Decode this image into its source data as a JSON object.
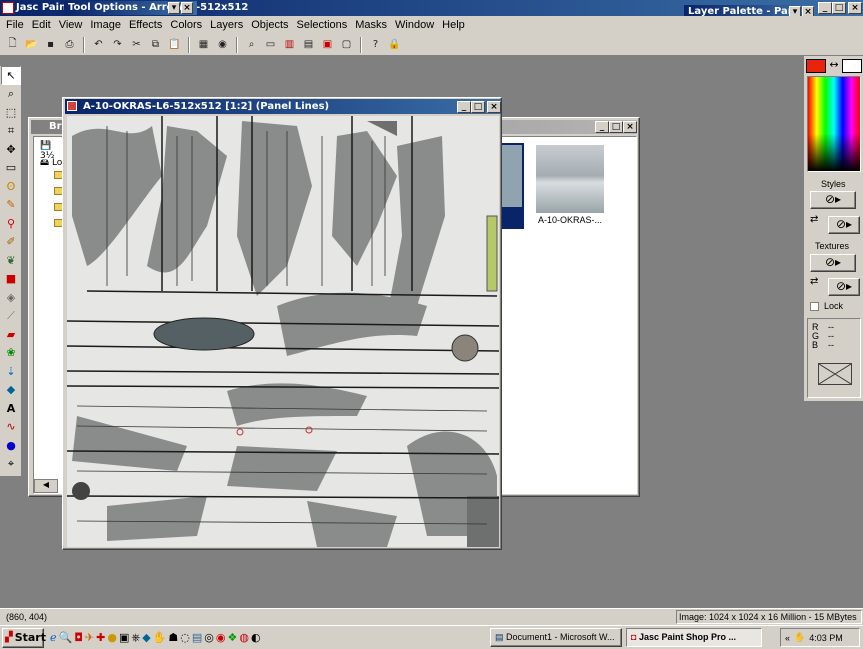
{
  "app": {
    "title_prefix": "Jasc Paint",
    "title_suffix": "-512x512",
    "tool_options_title": "Tool Options - Arrow",
    "layer_palette_title": "Layer Palette - Panel"
  },
  "menu": [
    "File",
    "Edit",
    "View",
    "Image",
    "Effects",
    "Colors",
    "Layers",
    "Objects",
    "Selections",
    "Masks",
    "Window",
    "Help"
  ],
  "toolbar_icons": [
    "new-icon",
    "open-icon",
    "save-icon",
    "print-icon",
    "undo-icon",
    "redo-icon",
    "cut-icon",
    "copy-icon",
    "paste-icon",
    "browse-icon",
    "screen-capture-icon",
    "zoom-icon",
    "overview-icon",
    "histogram-icon",
    "color-palette-icon",
    "tool-options-icon",
    "layer-palette-icon",
    "help-icon",
    "context-help-icon"
  ],
  "tools": [
    "arrow-tool-icon",
    "zoom-tool-icon",
    "deform-tool-icon",
    "crop-tool-icon",
    "mover-tool-icon",
    "selection-tool-icon",
    "freehand-tool-icon",
    "magic-wand-tool-icon",
    "dropper-tool-icon",
    "paintbrush-tool-icon",
    "clone-tool-icon",
    "color-replacer-tool-icon",
    "retouch-tool-icon",
    "scratch-remover-tool-icon",
    "eraser-tool-icon",
    "picture-tube-tool-icon",
    "airbrush-tool-icon",
    "flood-fill-tool-icon",
    "text-tool-icon",
    "draw-tool-icon",
    "preset-shapes-tool-icon",
    "vector-object-tool-icon"
  ],
  "browser": {
    "title": "Br",
    "tree_items": [
      "3½",
      "Lo"
    ],
    "thumbnail_label": "A-10-OKRAS-..."
  },
  "image_window": {
    "title": "A-10-OKRAS-L6-512x512 [1:2] (Panel Lines)"
  },
  "palette": {
    "styles_label": "Styles",
    "textures_label": "Textures",
    "lock_label": "Lock",
    "rgb_labels": [
      "R",
      "G",
      "B"
    ],
    "rgb_values": [
      "--",
      "--",
      "--"
    ],
    "fg_color": "#e8240c",
    "swap_symbol": "↔"
  },
  "status": {
    "coords": "(860, 404)",
    "image_info": "Image:  1024 x 1024 x 16 Million - 15 MBytes"
  },
  "taskbar": {
    "start_label": "Start",
    "tasks": [
      "Document1 - Microsoft W...",
      "Jasc Paint Shop Pro ..."
    ],
    "tray_arrows": "«",
    "clock": "4:03 PM"
  }
}
